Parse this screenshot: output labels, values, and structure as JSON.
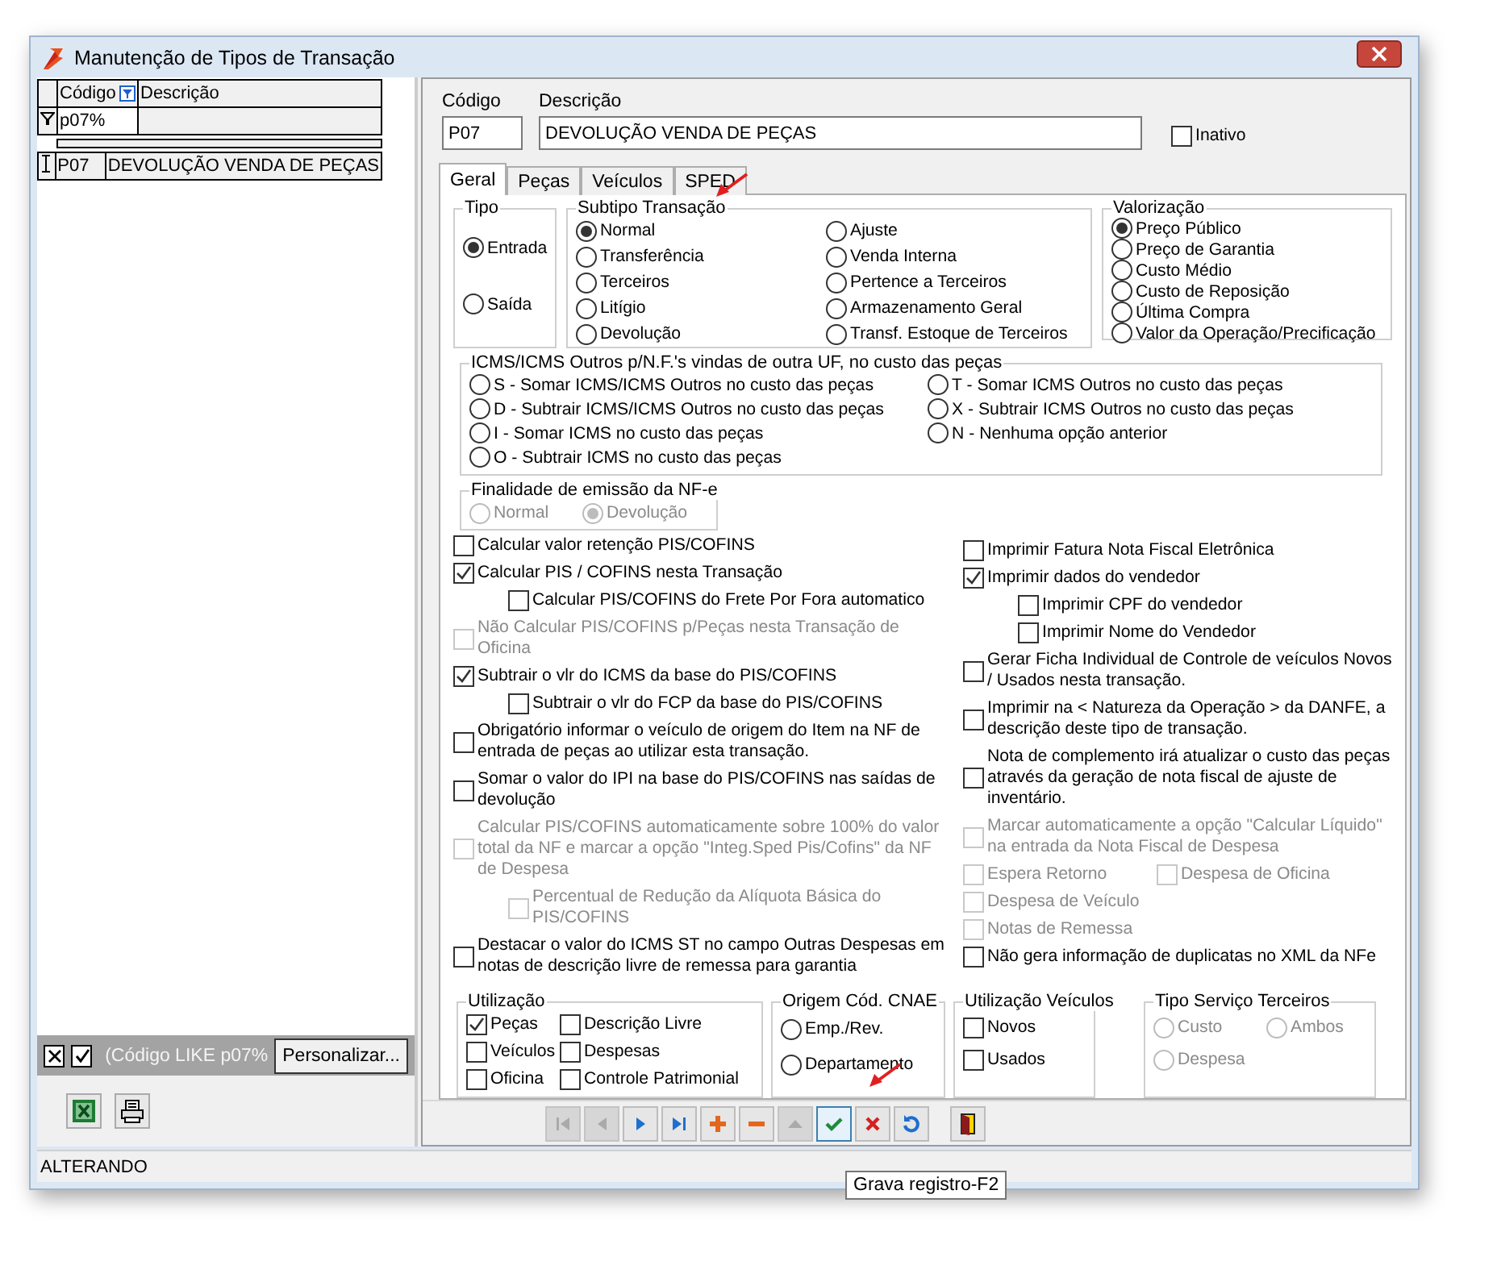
{
  "window": {
    "title": "Manutenção de Tipos de Transação"
  },
  "grid": {
    "columns": [
      "Código",
      "Descrição"
    ],
    "filter_value": "p07%",
    "rows": [
      [
        "P07",
        "DEVOLUÇÃO VENDA DE PEÇAS"
      ]
    ]
  },
  "filter_bar": {
    "text": "(Código LIKE p07%",
    "button": "Personalizar..."
  },
  "form": {
    "codigo_label": "Código",
    "codigo": "P07",
    "descricao_label": "Descrição",
    "descricao": "DEVOLUÇÃO VENDA DE PEÇAS",
    "inativo": {
      "label": "Inativo",
      "checked": false
    }
  },
  "tabs": [
    {
      "label": "Geral",
      "selected": true
    },
    {
      "label": "Peças",
      "selected": false
    },
    {
      "label": "Veículos",
      "selected": false
    },
    {
      "label": "SPED",
      "selected": false
    }
  ],
  "tipo": {
    "title": "Tipo",
    "options": [
      {
        "label": "Entrada",
        "selected": true
      },
      {
        "label": "Saída",
        "selected": false
      }
    ]
  },
  "subtipo": {
    "title": "Subtipo Transação",
    "options": [
      {
        "label": "Normal",
        "selected": true
      },
      {
        "label": "Transferência",
        "selected": false
      },
      {
        "label": "Terceiros",
        "selected": false
      },
      {
        "label": "Litígio",
        "selected": false
      },
      {
        "label": "Devolução",
        "selected": false
      },
      {
        "label": "Ajuste",
        "selected": false
      },
      {
        "label": "Venda Interna",
        "selected": false
      },
      {
        "label": "Pertence a Terceiros",
        "selected": false
      },
      {
        "label": "Armazenamento Geral",
        "selected": false
      },
      {
        "label": "Transf. Estoque de Terceiros",
        "selected": false
      }
    ]
  },
  "valorizacao": {
    "title": "Valorização",
    "options": [
      {
        "label": "Preço Público",
        "selected": true
      },
      {
        "label": "Preço de Garantia",
        "selected": false
      },
      {
        "label": "Custo Médio",
        "selected": false
      },
      {
        "label": "Custo de Reposição",
        "selected": false
      },
      {
        "label": "Última Compra",
        "selected": false
      },
      {
        "label": "Valor da Operação/Precificação",
        "selected": false
      }
    ]
  },
  "icms": {
    "title": "ICMS/ICMS Outros p/N.F.'s vindas de outra UF, no custo das peças",
    "options": [
      {
        "label": "S - Somar ICMS/ICMS Outros no custo das peças",
        "selected": false
      },
      {
        "label": "D - Subtrair ICMS/ICMS Outros no custo das peças",
        "selected": false
      },
      {
        "label": "I - Somar ICMS no custo das peças",
        "selected": false
      },
      {
        "label": "O - Subtrair ICMS no custo das peças",
        "selected": false
      },
      {
        "label": "T - Somar ICMS Outros no custo das peças",
        "selected": false
      },
      {
        "label": "X - Subtrair ICMS Outros no custo das peças",
        "selected": false
      },
      {
        "label": "N - Nenhuma opção anterior",
        "selected": false
      }
    ]
  },
  "finalidade": {
    "title": "Finalidade de emissão da NF-e",
    "options": [
      {
        "label": "Normal",
        "selected": false,
        "disabled": true
      },
      {
        "label": "Devolução",
        "selected": true,
        "disabled": true
      }
    ]
  },
  "checks_left": [
    {
      "kind": "check",
      "label": "Calcular valor retenção PIS/COFINS",
      "checked": false,
      "disabled": false
    },
    {
      "kind": "check",
      "label": "Calcular PIS / COFINS nesta Transação",
      "checked": true,
      "disabled": false,
      "children": [
        {
          "label": "Calcular PIS/COFINS do Frete Por Fora automatico",
          "checked": false,
          "disabled": false
        }
      ]
    },
    {
      "kind": "check",
      "label": "Não Calcular PIS/COFINS p/Peças nesta Transação de Oficina",
      "checked": false,
      "disabled": true
    },
    {
      "kind": "check",
      "label": "Subtrair o vlr do ICMS da base do PIS/COFINS",
      "checked": true,
      "disabled": false,
      "children": [
        {
          "label": "Subtrair o vlr do FCP da base do PIS/COFINS",
          "checked": false,
          "disabled": false
        }
      ]
    },
    {
      "kind": "check",
      "label": "Obrigatório informar o veículo de origem do Item na NF de entrada de peças ao utilizar esta transação.",
      "checked": false,
      "disabled": false
    },
    {
      "kind": "check",
      "label": "Somar o valor do IPI na base do PIS/COFINS nas saídas de devolução",
      "checked": false,
      "disabled": false
    },
    {
      "kind": "check",
      "label": "Calcular PIS/COFINS automaticamente sobre 100% do valor total da NF e marcar a opção \"Integ.Sped Pis/Cofins\" da NF de Despesa",
      "checked": false,
      "disabled": true,
      "children": [
        {
          "label": "Percentual de Redução da Alíquota Básica do PIS/COFINS",
          "checked": false,
          "disabled": true
        }
      ]
    },
    {
      "kind": "check",
      "label": "Destacar o valor do ICMS ST no campo Outras Despesas em notas de descrição livre de remessa para garantia",
      "checked": false,
      "disabled": false
    }
  ],
  "checks_right": [
    {
      "kind": "check",
      "label": "Imprimir Fatura Nota Fiscal Eletrônica",
      "checked": false,
      "disabled": false
    },
    {
      "kind": "check",
      "label": "Imprimir dados do vendedor",
      "checked": true,
      "disabled": false,
      "children": [
        {
          "label": "Imprimir CPF do vendedor",
          "checked": false,
          "disabled": false
        },
        {
          "label": "Imprimir Nome do Vendedor",
          "checked": false,
          "disabled": false
        }
      ]
    },
    {
      "kind": "check",
      "label": "Gerar Ficha Individual de Controle de veículos Novos / Usados  nesta transação.",
      "checked": false,
      "disabled": false
    },
    {
      "kind": "check",
      "label": "Imprimir na < Natureza da Operação > da DANFE, a descrição deste tipo de transação.",
      "checked": false,
      "disabled": false
    },
    {
      "kind": "check",
      "label": "Nota de complemento irá atualizar o custo das peças através da geração de nota fiscal de ajuste de inventário.",
      "checked": false,
      "disabled": false
    },
    {
      "kind": "check",
      "label": "Marcar automaticamente a opção \"Calcular Líquido\" na entrada da Nota Fiscal de Despesa",
      "checked": false,
      "disabled": true
    },
    {
      "kind": "pair",
      "items": [
        {
          "label": "Espera Retorno",
          "checked": false,
          "disabled": true
        },
        {
          "label": "Despesa de Oficina",
          "checked": false,
          "disabled": true
        }
      ]
    },
    {
      "kind": "check",
      "label": "Despesa de Veículo",
      "checked": false,
      "disabled": true
    },
    {
      "kind": "check",
      "label": "Notas de Remessa",
      "checked": false,
      "disabled": true
    },
    {
      "kind": "check",
      "label": "Não gera informação de duplicatas no XML da NFe",
      "checked": false,
      "disabled": false
    }
  ],
  "utilizacao": {
    "title": "Utilização",
    "options": [
      {
        "label": "Peças",
        "checked": true
      },
      {
        "label": "Veículos",
        "checked": false
      },
      {
        "label": "Oficina",
        "checked": false
      },
      {
        "label": "Descrição Livre",
        "checked": false
      },
      {
        "label": "Despesas",
        "checked": false
      },
      {
        "label": "Controle Patrimonial",
        "checked": false
      }
    ]
  },
  "origem_cnae": {
    "title": "Origem Cód. CNAE",
    "options": [
      {
        "label": "Emp./Rev.",
        "selected": false
      },
      {
        "label": "Departamento",
        "selected": false
      }
    ]
  },
  "utilizacao_veiculos": {
    "title": "Utilização Veículos",
    "options": [
      {
        "label": "Novos",
        "checked": false
      },
      {
        "label": "Usados",
        "checked": false
      }
    ]
  },
  "tipo_servico": {
    "title": "Tipo Serviço Terceiros",
    "options": [
      {
        "label": "Custo",
        "selected": false,
        "disabled": true
      },
      {
        "label": "Ambos",
        "selected": false,
        "disabled": true
      },
      {
        "label": "Despesa",
        "selected": false,
        "disabled": true
      }
    ]
  },
  "toolbar": [
    {
      "kind": "first",
      "disabled": true,
      "focused": false
    },
    {
      "kind": "prev",
      "disabled": true,
      "focused": false
    },
    {
      "kind": "next",
      "disabled": false,
      "focused": false
    },
    {
      "kind": "last",
      "disabled": false,
      "focused": false
    },
    {
      "kind": "add",
      "disabled": false,
      "focused": false
    },
    {
      "kind": "delete",
      "disabled": false,
      "focused": false
    },
    {
      "kind": "post",
      "disabled": true,
      "focused": false
    },
    {
      "kind": "save",
      "disabled": false,
      "focused": true
    },
    {
      "kind": "cancel",
      "disabled": false,
      "focused": false
    },
    {
      "kind": "refresh",
      "disabled": false,
      "focused": false
    },
    {
      "kind": "exit",
      "disabled": false,
      "focused": false
    }
  ],
  "tooltip": "Grava registro-F2",
  "status_bar": "ALTERANDO"
}
